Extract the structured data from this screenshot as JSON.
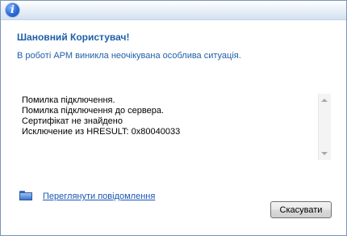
{
  "dialog": {
    "icon": "info-icon",
    "heading": "Шановний Користувач!",
    "subheading": "В роботі АРМ виникла неочікувана особлива ситуація.",
    "error_lines": [
      "Помилка підключення.",
      "Помилка підключення до сервера.",
      "Сертифікат не знайдено",
      "Исключение из HRESULT: 0x80040033"
    ],
    "view_messages_icon": "folder-icon",
    "view_messages_link": "Переглянути повідомлення",
    "cancel_label": "Скасувати"
  }
}
